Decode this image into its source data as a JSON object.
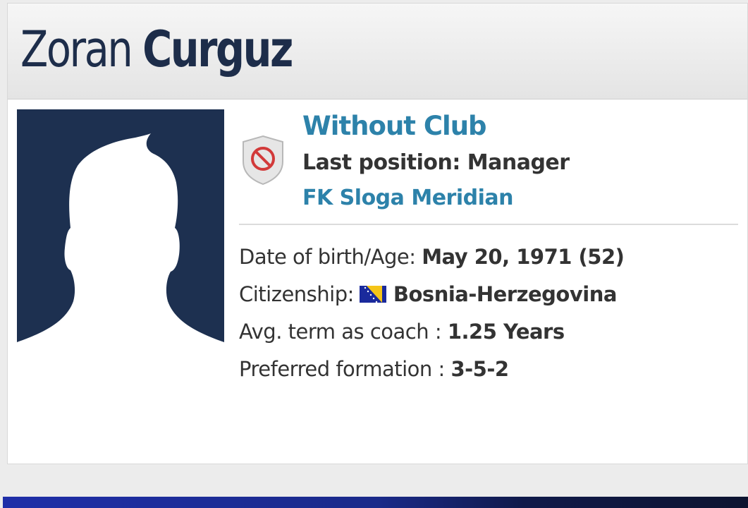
{
  "profile": {
    "first_name": "Zoran",
    "last_name": "Curguz"
  },
  "club": {
    "status": "Without Club",
    "last_position": "Last position: Manager",
    "last_club": "FK Sloga Meridian",
    "badge_icon": "no-entry-shield-icon"
  },
  "details": {
    "dob_label": "Date of birth/Age:",
    "dob_value": "May 20, 1971 (52)",
    "citizenship_label": "Citizenship:",
    "citizenship_value": "Bosnia-Herzegovina",
    "citizenship_flag": "bosnia-herzegovina-flag",
    "avg_term_label": "Avg. term as coach :",
    "avg_term_value": "1.25 Years",
    "formation_label": "Preferred formation :",
    "formation_value": "3-5-2"
  },
  "colors": {
    "name": "#1d2d4a",
    "link": "#2d82aa",
    "photo_bg": "#1d3050",
    "bottom_bar": "#1f2ea8"
  }
}
